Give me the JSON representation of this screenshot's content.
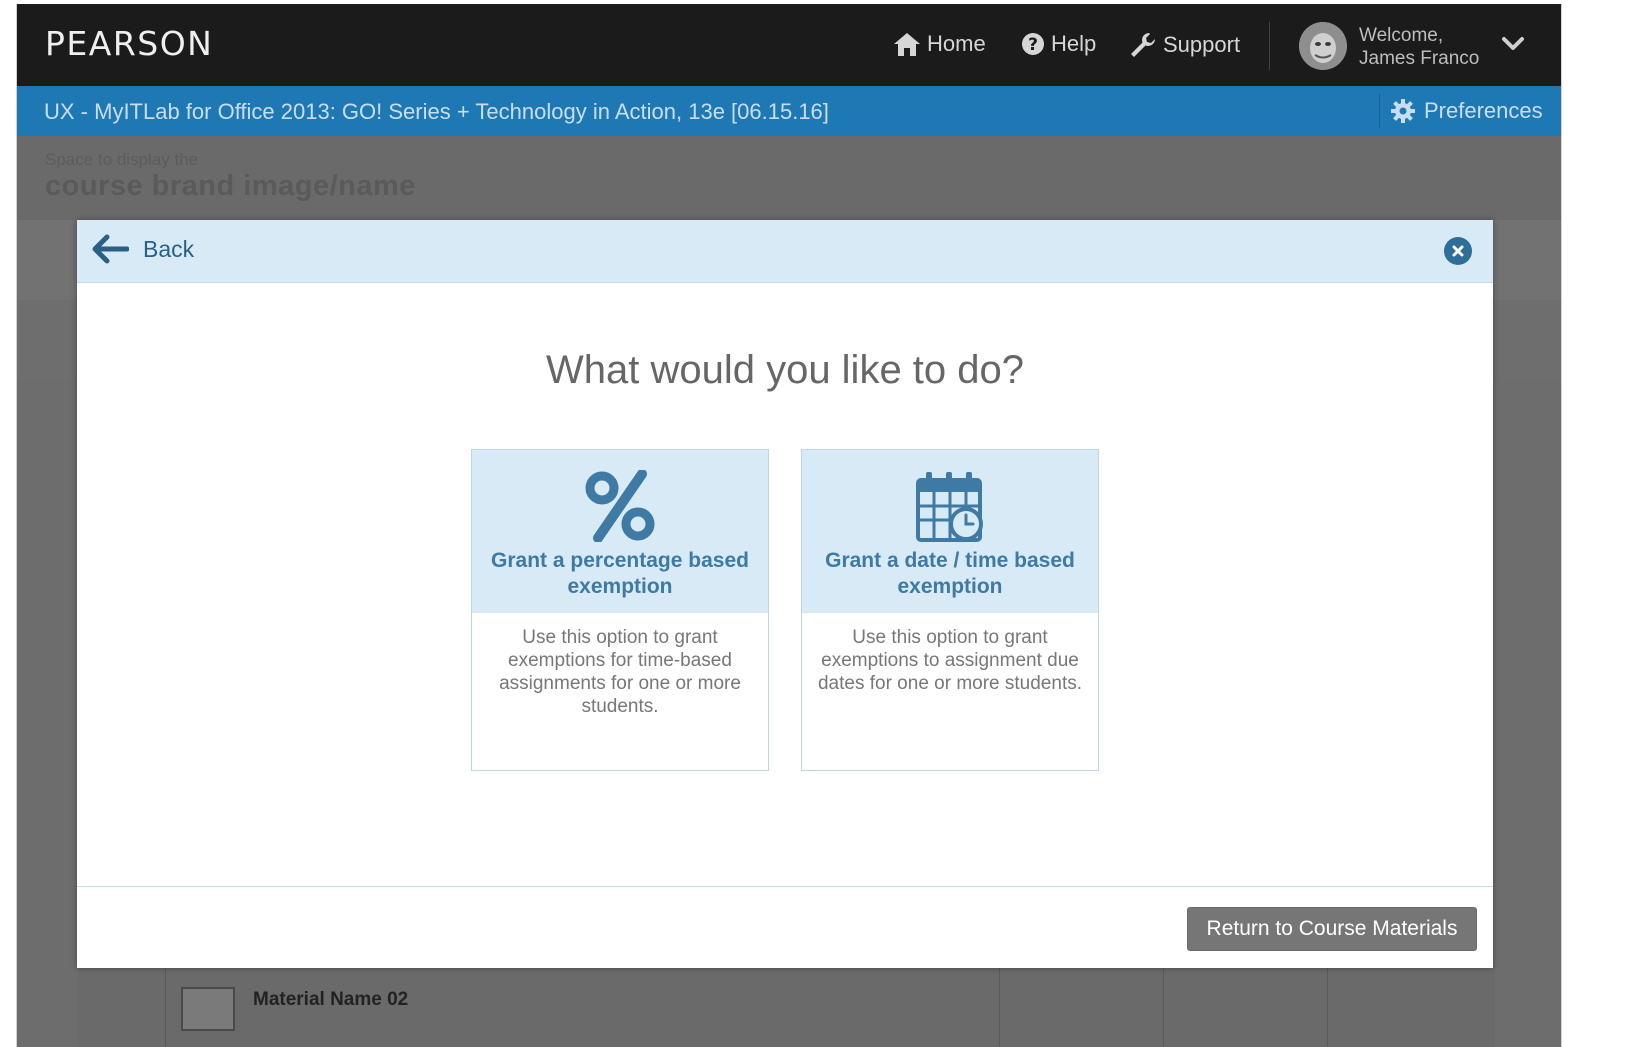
{
  "header": {
    "logo": "PEARSON",
    "nav": [
      {
        "label": "Home",
        "icon": "home-icon"
      },
      {
        "label": "Help",
        "icon": "help-icon"
      },
      {
        "label": "Support",
        "icon": "wrench-icon"
      }
    ],
    "welcome_line1": "Welcome,",
    "welcome_line2": "James Franco"
  },
  "course_bar": {
    "title": "UX - MyITLab for Office 2013: GO! Series + Technology in Action, 13e [06.15.16]",
    "preferences_label": "Preferences"
  },
  "brand": {
    "small": "Space to display the",
    "big": "course brand image/name"
  },
  "background_row": {
    "material_name": "Material Name 02"
  },
  "modal": {
    "back_label": "Back",
    "question": "What would you like to do?",
    "options": [
      {
        "icon": "percent-icon",
        "title_line1": "Grant a percentage based",
        "title_line2": "exemption",
        "description": "Use this option to grant exemptions for time-based assignments for one or more students."
      },
      {
        "icon": "calendar-clock-icon",
        "title_line1": "Grant a date / time based",
        "title_line2": "exemption",
        "description": "Use this option to grant exemptions to assignment due dates for one or more students."
      }
    ],
    "return_button": "Return to Course Materials"
  },
  "colors": {
    "topbar": "#1b1b1b",
    "course_bar": "#1e78b4",
    "accent": "#3e7aa3",
    "card_header": "#d8eaf5"
  }
}
